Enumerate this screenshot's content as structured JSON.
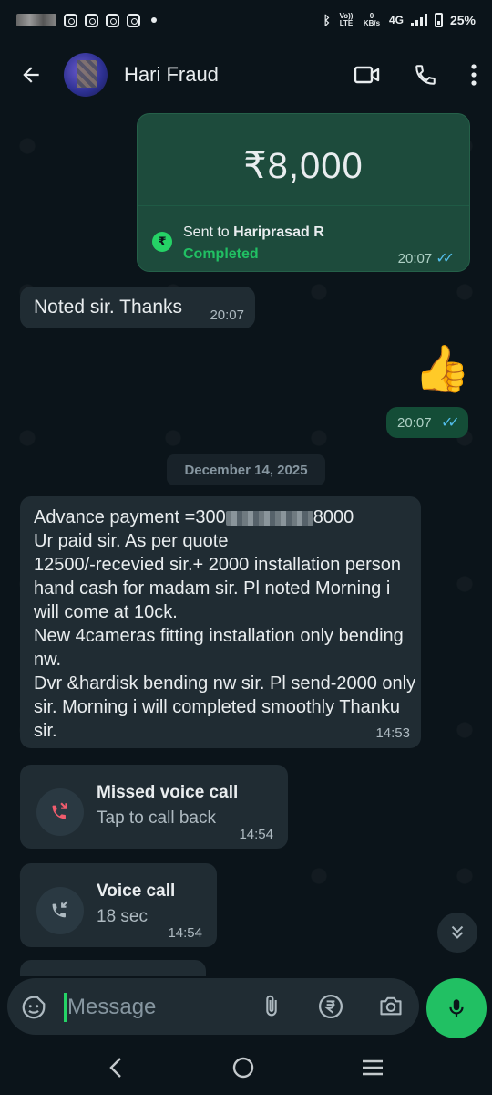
{
  "status_bar": {
    "network_type": "4G",
    "volte_label": "Vo)) LTE",
    "speed_value": "0",
    "speed_unit": "KB/s",
    "battery": "25%"
  },
  "header": {
    "contact_name": "Hari Fraud"
  },
  "payment": {
    "amount": "₹8,000",
    "sent_prefix": "Sent to ",
    "recipient": "Hariprasad R",
    "status": "Completed",
    "time": "20:07"
  },
  "messages": {
    "noted": {
      "text": "Noted sir. Thanks",
      "time": "20:07"
    },
    "thumbs": {
      "emoji": "👍",
      "time": "20:07"
    },
    "date_chip": "December 14, 2025",
    "advance": {
      "line1_start": "Advance payment =300",
      "line1_end": "8000",
      "rest": "Ur paid sir. As per quote\n12500/-recevied sir.+ 2000 installation person hand cash for madam sir. Pl noted Morning i will come at 10ck.\nNew 4cameras fitting installation only bending nw.\nDvr &hardisk bending nw sir. Pl send-2000 only sir. Morning i will completed smoothly Thanku sir.",
      "time": "14:53"
    },
    "missed_call": {
      "title": "Missed voice call",
      "subtitle": "Tap to call back",
      "time": "14:54"
    },
    "voice_call": {
      "title": "Voice call",
      "subtitle": "18 sec",
      "time": "14:54"
    }
  },
  "input": {
    "placeholder": "Message"
  },
  "colors": {
    "accent": "#21c063",
    "bubble_out": "#144d37",
    "bubble_in": "#202c33",
    "background": "#0b141a",
    "read_ticks": "#53bdeb",
    "missed_red": "#f15c6d"
  },
  "icons": [
    "back-arrow-icon",
    "video-call-icon",
    "phone-icon",
    "more-vert-icon",
    "rupee-icon",
    "double-check-icon",
    "missed-call-icon",
    "incoming-call-icon",
    "chevron-double-down-icon",
    "sticker-icon",
    "attach-icon",
    "rupee-circle-icon",
    "camera-icon",
    "mic-icon",
    "nav-back-icon",
    "nav-home-icon",
    "nav-recents-icon"
  ]
}
